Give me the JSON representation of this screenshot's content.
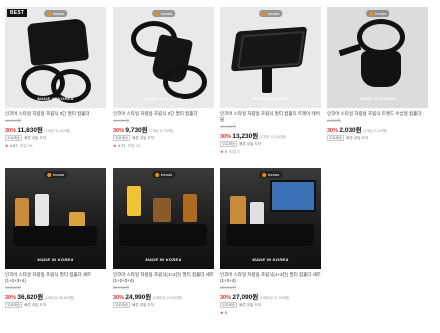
{
  "badges": {
    "best": "BEST"
  },
  "brand": "incoas",
  "made_in": "MADE IN KOREA",
  "tags": {
    "t1": "무료배송",
    "t2": "빠른 내일 도착"
  },
  "products": [
    {
      "title": "인코어 스타일 차량용 조립식 3단 멀티 컵홀더",
      "orig": "16,900원",
      "discount": "30%",
      "price": "11,830원",
      "unit": "(1개당 11,830원)",
      "rating": "4.87",
      "reviews": "리뷰 38"
    },
    {
      "title": "인코어 스타일 차량용 조립식 2단 멀티 컵홀더",
      "orig": "13,900원",
      "discount": "30%",
      "price": "9,730원",
      "unit": "(1개당 9,730원)",
      "rating": "4.71",
      "reviews": "리뷰 24"
    },
    {
      "title": "인코어 스타일 차량용 조립식 멀티 컵홀더 트레이 테이블",
      "orig": "18,900원",
      "discount": "30%",
      "price": "13,230원",
      "unit": "(1개당 13,230원)",
      "rating": "5",
      "reviews": "리뷰 3"
    },
    {
      "title": "인코어 스타일 차량용 조립식 트렌드 수납형 컵홀더",
      "orig": "2,900원",
      "discount": "30%",
      "price": "2,030원",
      "unit": "(1개당 2,030원)",
      "rating": "",
      "reviews": ""
    },
    {
      "title": "인코어 스타일 차량용 조립식 멀티 컵홀더 세트 (1+2+3+4)",
      "orig": "52,600원",
      "discount": "30%",
      "price": "36,820원",
      "unit": "(1세트당 36,820원)",
      "rating": "",
      "reviews": ""
    },
    {
      "title": "인코어 스타일 차량용 조립식(1+2단) 멀티 컵홀더 세트 (1+2+3+4)",
      "orig": "35,700원",
      "discount": "30%",
      "price": "24,990원",
      "unit": "(1세트당 24,990원)",
      "rating": "",
      "reviews": ""
    },
    {
      "title": "인코어 스타일 차량용 조립식(1+3단) 멀티 컵홀더 세트 (1+3+4)",
      "orig": "38,700원",
      "discount": "30%",
      "price": "27,090원",
      "unit": "(1세트당 27,090원)",
      "rating": "5",
      "reviews": ""
    }
  ]
}
